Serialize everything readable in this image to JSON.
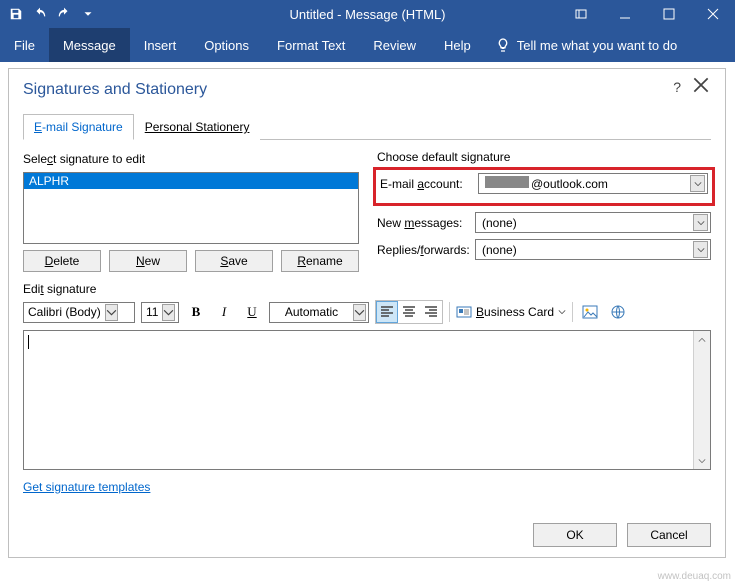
{
  "app": {
    "title": "Untitled  -  Message (HTML)"
  },
  "ribbon": {
    "tabs": [
      "File",
      "Message",
      "Insert",
      "Options",
      "Format Text",
      "Review",
      "Help"
    ],
    "tell_me": "Tell me what you want to do"
  },
  "dialog": {
    "title": "Signatures and Stationery",
    "tabs": {
      "email": "E-mail Signature",
      "personal": "Personal Stationery"
    },
    "select_label": "Select signature to edit",
    "signatures": [
      "ALPHR"
    ],
    "buttons": {
      "delete": "Delete",
      "new": "New",
      "save": "Save",
      "rename": "Rename"
    },
    "choose_label": "Choose default signature",
    "email_account_label": "E-mail account:",
    "email_account_value": "@outlook.com",
    "new_messages_label": "New messages:",
    "new_messages_value": "(none)",
    "replies_label": "Replies/forwards:",
    "replies_value": "(none)",
    "edit_label": "Edit signature",
    "font": "Calibri (Body)",
    "font_size": "11",
    "color": "Automatic",
    "business_card": "Business Card",
    "templates_link": "Get signature templates",
    "ok": "OK",
    "cancel": "Cancel"
  },
  "watermark": "www.deuaq.com"
}
